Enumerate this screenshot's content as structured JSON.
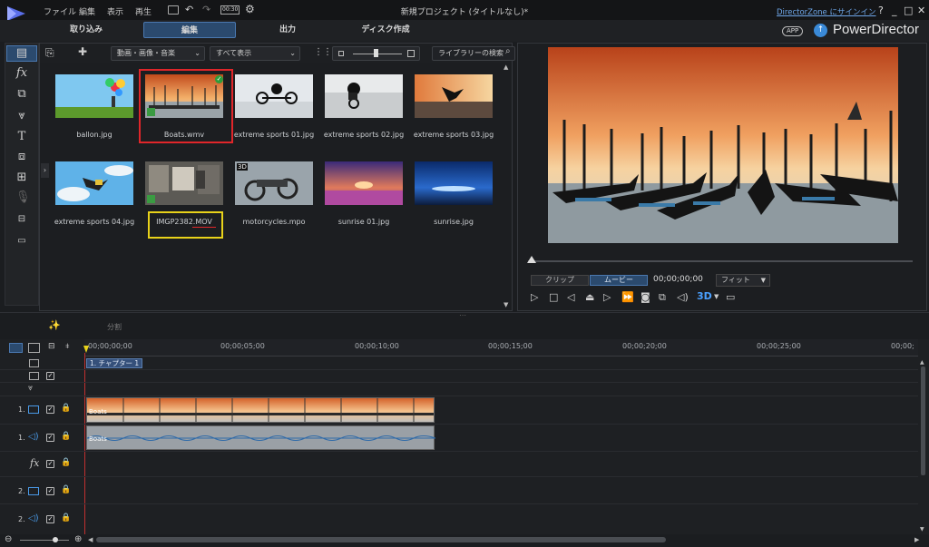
{
  "menu": [
    "ファイル",
    "編集",
    "表示",
    "再生"
  ],
  "title_bar": {
    "timecode_icon": "00:30",
    "title": "新規プロジェクト (タイトルなし)*",
    "signin_link": "DirectorZone にサインイン",
    "controls": [
      "?",
      "_",
      "□",
      "✕"
    ]
  },
  "nav_tabs": [
    "取り込み",
    "編集",
    "出力",
    "ディスク作成"
  ],
  "brand": {
    "app_badge": "APP",
    "name": "PowerDirector"
  },
  "library": {
    "filter_dropdown": "動画・画像・音楽",
    "show_dropdown": "すべて表示",
    "search_placeholder": "ライブラリーの検索",
    "items": [
      {
        "name": "ballon.jpg"
      },
      {
        "name": "Boats.wmv",
        "selected": true
      },
      {
        "name": "extreme sports 01.jpg"
      },
      {
        "name": "extreme sports 02.jpg"
      },
      {
        "name": "extreme sports 03.jpg"
      },
      {
        "name": "extreme sports 04.jpg"
      },
      {
        "name": "IMGP2382.MOV",
        "highlighted": true
      },
      {
        "name": "motorcycles.mpo",
        "badge": "3D"
      },
      {
        "name": "sunrise 01.jpg"
      },
      {
        "name": "sunrise.jpg"
      }
    ]
  },
  "preview": {
    "mode_clip": "クリップ",
    "mode_movie": "ムービー",
    "timecode": "00;00;00;00",
    "fit": "フィット",
    "button_3d": "3D"
  },
  "timeline": {
    "split_label": "分割",
    "ruler": [
      "00;00;00;00",
      "00;00;05;00",
      "00;00;10;00",
      "00;00;15;00",
      "00;00;20;00",
      "00;00;25;00",
      "00;00;"
    ],
    "chapter": "1. チャプター 1",
    "tracks": [
      {
        "label": "1.",
        "type": "video",
        "clip": "Boats"
      },
      {
        "label": "1.",
        "type": "audio",
        "clip": "Boats"
      },
      {
        "label": "fx",
        "type": "fx"
      },
      {
        "label": "2.",
        "type": "video"
      },
      {
        "label": "2.",
        "type": "audio"
      }
    ]
  },
  "colors": {
    "accent": "#3a8ad8",
    "selection_red": "#e0262a",
    "selection_yellow": "#e8d21a",
    "playhead": "#c03030"
  }
}
